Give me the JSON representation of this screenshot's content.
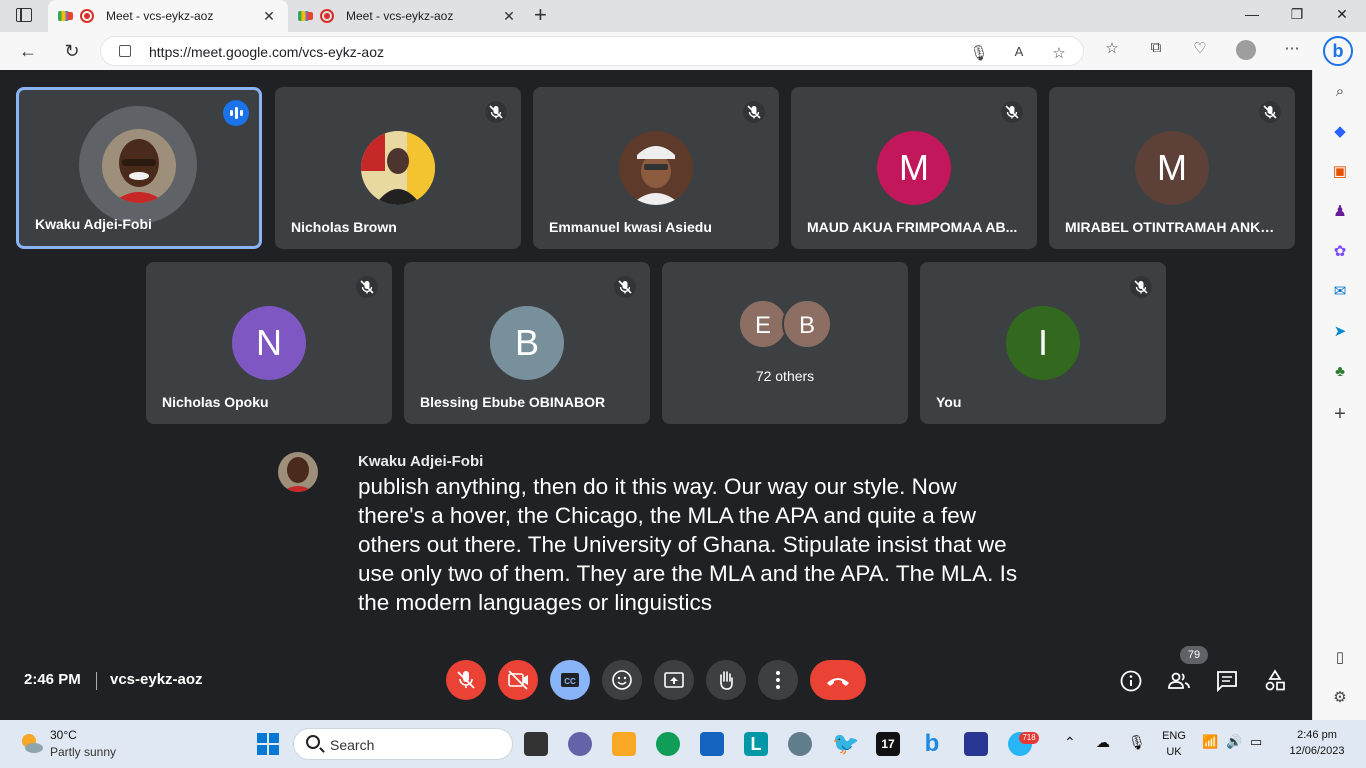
{
  "browser": {
    "tabs": [
      {
        "title": "Meet - vcs-eykz-aoz",
        "active": true
      },
      {
        "title": "Meet - vcs-eykz-aoz",
        "active": false
      }
    ],
    "url": "https://meet.google.com/vcs-eykz-aoz",
    "profile_letter": "b"
  },
  "participants_row1": [
    {
      "name": "Kwaku Adjei-Fobi",
      "type": "photo",
      "speaking": true
    },
    {
      "name": "Nicholas Brown",
      "type": "photo",
      "speaking": false
    },
    {
      "name": "Emmanuel kwasi Asiedu",
      "type": "photo",
      "speaking": false
    },
    {
      "name": "MAUD AKUA FRIMPOMAA AB...",
      "type": "letter",
      "letter": "M",
      "color": "#c2185b"
    },
    {
      "name": "MIRABEL OTINTRAMAH ANKR...",
      "type": "letter",
      "letter": "M",
      "color": "#5d4037"
    }
  ],
  "participants_row2": [
    {
      "name": "Nicholas Opoku",
      "type": "letter",
      "letter": "N",
      "color": "#7e57c2"
    },
    {
      "name": "Blessing Ebube OBINABOR",
      "type": "letter",
      "letter": "B",
      "color": "#78909c"
    },
    {
      "name": "72 others",
      "type": "group",
      "letters": [
        "E",
        "B"
      ],
      "colors": [
        "#8d6e63",
        "#8d6e63"
      ]
    },
    {
      "name": "You",
      "type": "letter",
      "letter": "I",
      "color": "#33691e"
    }
  ],
  "caption": {
    "speaker": "Kwaku Adjei-Fobi",
    "text": "publish anything, then do it this way. Our way our style. Now there's a hover, the Chicago, the MLA the APA and quite a few others out there. The University of Ghana. Stipulate insist that we use only two of them. They are the MLA and the APA. The MLA. Is the modern languages or linguistics"
  },
  "meeting": {
    "time": "2:46 PM",
    "code": "vcs-eykz-aoz",
    "people_count": "79"
  },
  "controls": [
    "mic-off",
    "camera-off",
    "captions",
    "emoji",
    "present",
    "raise-hand",
    "more-options",
    "leave-call"
  ],
  "taskbar": {
    "weather_temp": "30°C",
    "weather_desc": "Partly sunny",
    "search_placeholder": "Search",
    "telegram_badge": "718",
    "lang": "ENG",
    "region": "UK",
    "clock_time": "2:46 pm",
    "clock_date": "12/06/2023"
  }
}
